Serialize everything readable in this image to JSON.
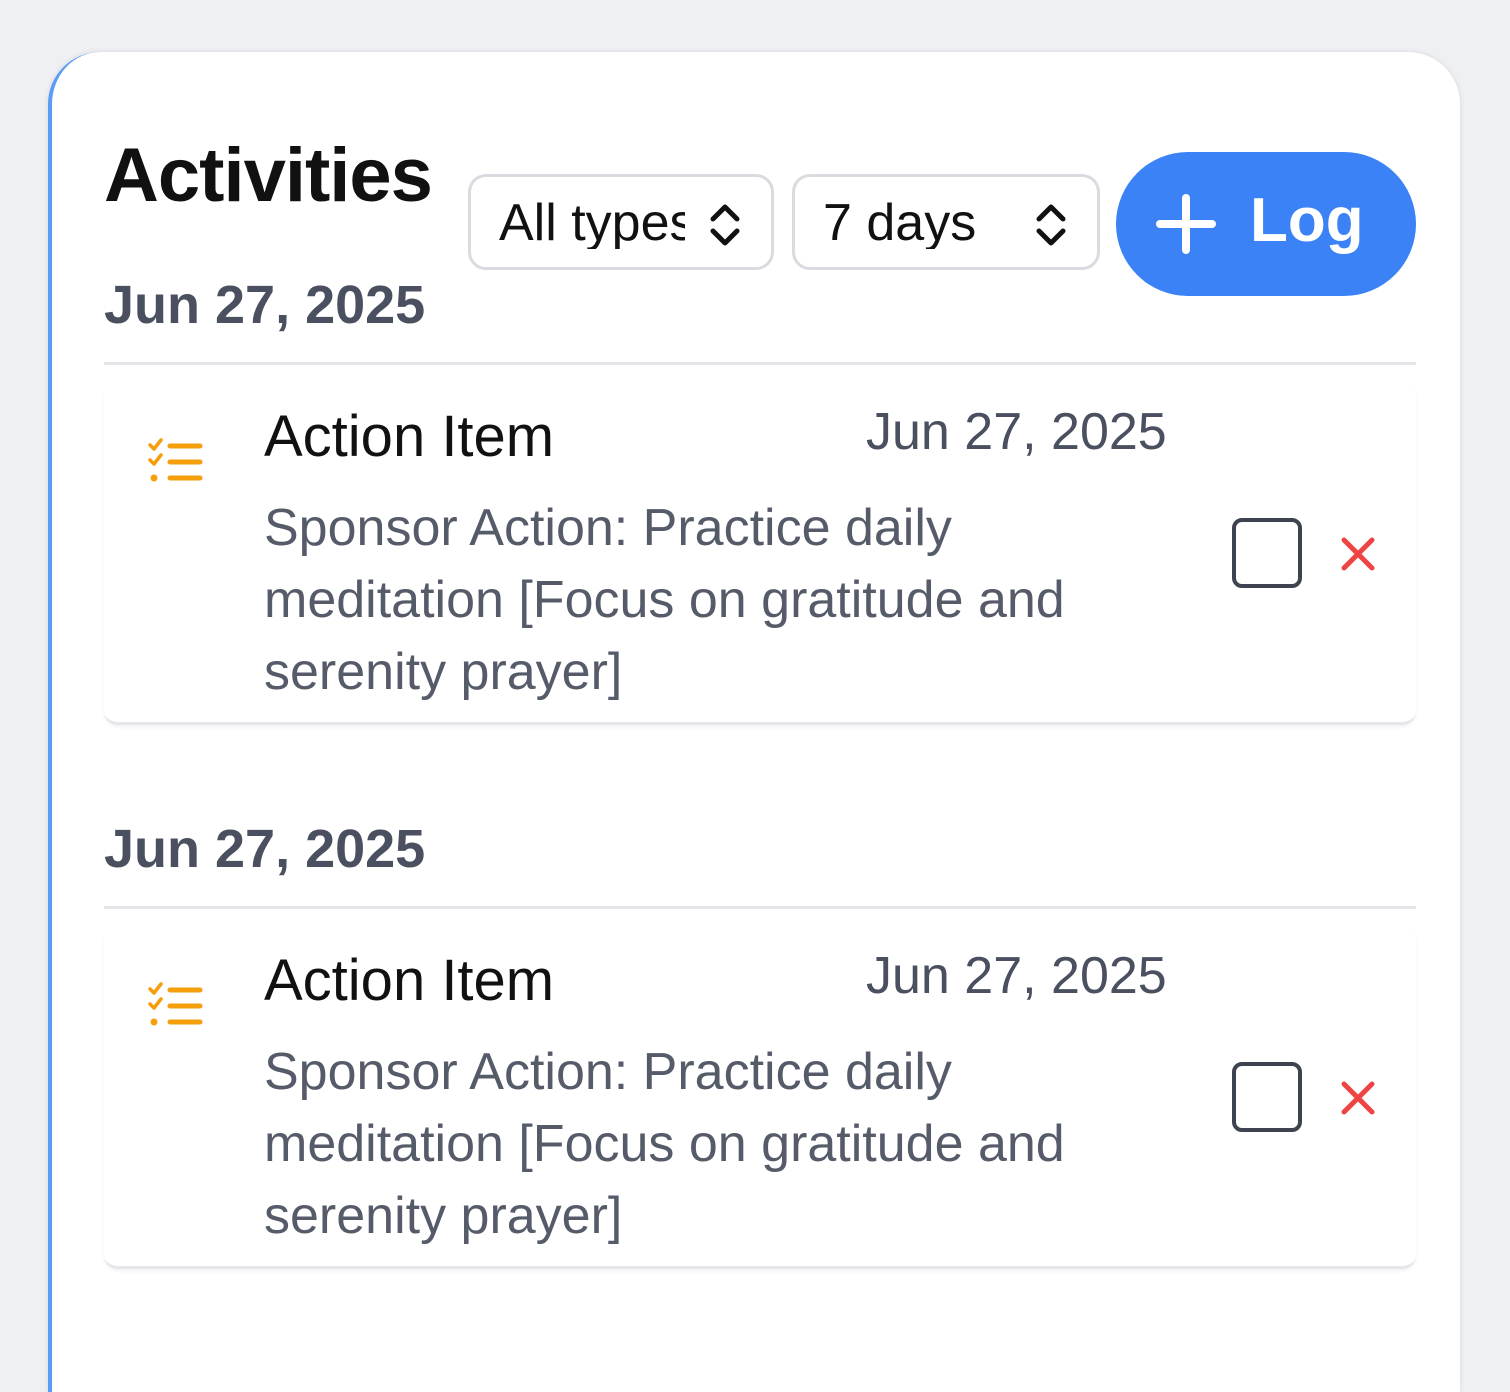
{
  "header": {
    "title": "Activities",
    "type_filter": "All types",
    "range_filter": "7 days",
    "log_button": "Log"
  },
  "groups": [
    {
      "date": "Jun 27, 2025",
      "items": [
        {
          "type": "Action Item",
          "date": "Jun 27, 2025",
          "description": "Sponsor Action: Practice daily meditation [Focus on gratitude and serenity prayer]",
          "icon": "checklist-icon"
        }
      ]
    },
    {
      "date": "Jun 27, 2025",
      "items": [
        {
          "type": "Action Item",
          "date": "Jun 27, 2025",
          "description": "Sponsor Action: Practice daily meditation [Focus on gratitude and serenity prayer]",
          "icon": "checklist-icon"
        }
      ]
    }
  ],
  "colors": {
    "accent": "#3b82f6",
    "icon": "#f59e0b",
    "delete": "#ef4444"
  }
}
